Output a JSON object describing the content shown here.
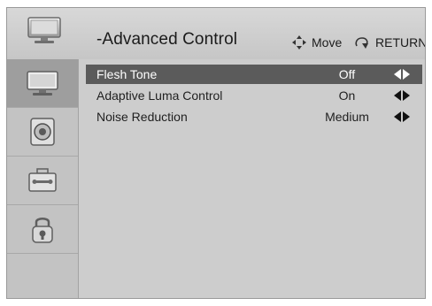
{
  "header": {
    "title": "-Advanced Control",
    "move_label": "Move",
    "return_label": "RETURN",
    "tv_icon": "tv-icon",
    "move_icon": "move-arrows-icon",
    "return_icon": "return-icon"
  },
  "sidebar": {
    "items": [
      {
        "icon": "picture-tv-icon",
        "active": true
      },
      {
        "icon": "audio-speaker-icon",
        "active": false
      },
      {
        "icon": "setup-toolbox-icon",
        "active": false
      },
      {
        "icon": "lock-icon",
        "active": false
      }
    ]
  },
  "settings": [
    {
      "label": "Flesh Tone",
      "value": "Off",
      "selected": true
    },
    {
      "label": "Adaptive Luma Control",
      "value": "On",
      "selected": false
    },
    {
      "label": "Noise Reduction",
      "value": "Medium",
      "selected": false
    }
  ],
  "colors": {
    "selected_row": "#5b5b5b",
    "panel": "#cdcdcd",
    "sidebar_active": "#9e9e9e"
  }
}
